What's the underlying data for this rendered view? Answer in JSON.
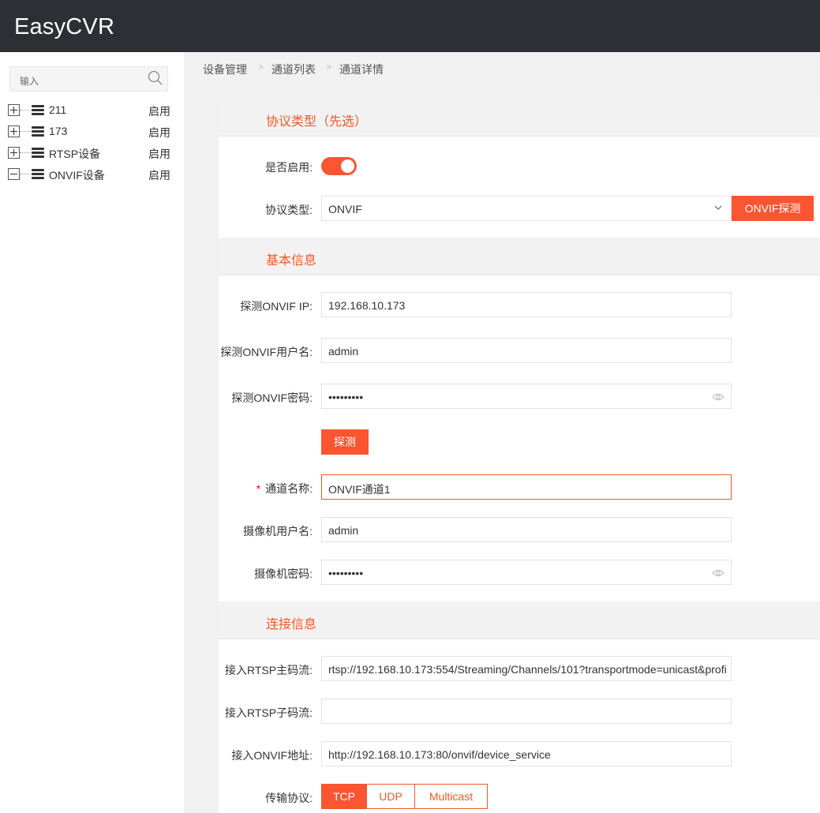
{
  "app": {
    "title": "EasyCVR"
  },
  "sidebar": {
    "search_placeholder": "输入",
    "tree": [
      {
        "label": "211",
        "status": "启用",
        "expanded": false
      },
      {
        "label": "173",
        "status": "启用",
        "expanded": false
      },
      {
        "label": "RTSP设备",
        "status": "启用",
        "expanded": false
      },
      {
        "label": "ONVIF设备",
        "status": "启用",
        "expanded": true
      }
    ]
  },
  "breadcrumb": [
    "设备管理",
    "通道列表",
    "通道详情"
  ],
  "breadcrumb_sep": ">",
  "sections": {
    "protocol": "协议类型（先选）",
    "basic": "基本信息",
    "connection": "连接信息"
  },
  "form": {
    "enabled_label": "是否启用:",
    "enabled": true,
    "protocol_label": "协议类型:",
    "protocol_value": "ONVIF",
    "onvif_probe_button": "ONVIF探测",
    "probe_ip_label": "探测ONVIF IP:",
    "probe_ip_value": "192.168.10.173",
    "probe_user_label": "探测ONVIF用户名:",
    "probe_user_value": "admin",
    "probe_pass_label": "探测ONVIF密码:",
    "probe_pass_value": "•••••••••",
    "probe_button": "探测",
    "required_mark": "*",
    "channel_name_label": "通道名称:",
    "channel_name_value": "ONVIF通道1",
    "camera_user_label": "摄像机用户名:",
    "camera_user_value": "admin",
    "camera_pass_label": "摄像机密码:",
    "camera_pass_value": "•••••••••",
    "rtsp_main_label": "接入RTSP主码流:",
    "rtsp_main_value": "rtsp://192.168.10.173:554/Streaming/Channels/101?transportmode=unicast&profi",
    "rtsp_sub_label": "接入RTSP子码流:",
    "rtsp_sub_value": "",
    "onvif_addr_label": "接入ONVIF地址:",
    "onvif_addr_value": "http://192.168.10.173:80/onvif/device_service",
    "transport_label": "传输协议:",
    "transport_options": [
      "TCP",
      "UDP",
      "Multicast"
    ],
    "transport_selected": "TCP"
  },
  "colors": {
    "accent": "#fc5531",
    "topbar": "#2c2f33"
  }
}
